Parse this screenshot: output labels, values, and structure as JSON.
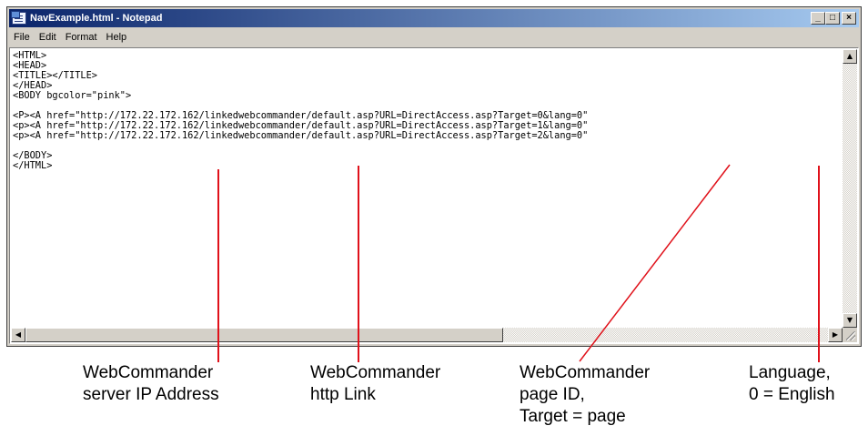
{
  "window": {
    "title": "NavExample.html - Notepad",
    "buttons": {
      "minimize": "_",
      "maximize": "□",
      "close": "×"
    }
  },
  "menu": [
    "File",
    "Edit",
    "Format",
    "Help"
  ],
  "editor": {
    "lines": [
      "<HTML>",
      "<HEAD>",
      "<TITLE></TITLE>",
      "</HEAD>",
      "<BODY bgcolor=\"pink\">",
      "",
      "<P><A href=\"http://172.22.172.162/linkedwebcommander/default.asp?URL=DirectAccess.asp?Target=0&lang=0\"",
      "<p><A href=\"http://172.22.172.162/linkedwebcommander/default.asp?URL=DirectAccess.asp?Target=1&lang=0\"",
      "<p><A href=\"http://172.22.172.162/linkedwebcommander/default.asp?URL=DirectAccess.asp?Target=2&lang=0\"",
      "",
      "</BODY>",
      "</HTML>"
    ]
  },
  "annotations": {
    "server_ip": [
      "WebCommander",
      "server IP Address"
    ],
    "http_link": [
      "WebCommander",
      "http Link"
    ],
    "page_id": [
      "WebCommander",
      "page ID,",
      "Target = page"
    ],
    "language": [
      "Language,",
      "0 = English"
    ]
  },
  "colors": {
    "callout": "#e0111a",
    "titlebar_start": "#0a246a",
    "titlebar_end": "#a6caf0"
  }
}
